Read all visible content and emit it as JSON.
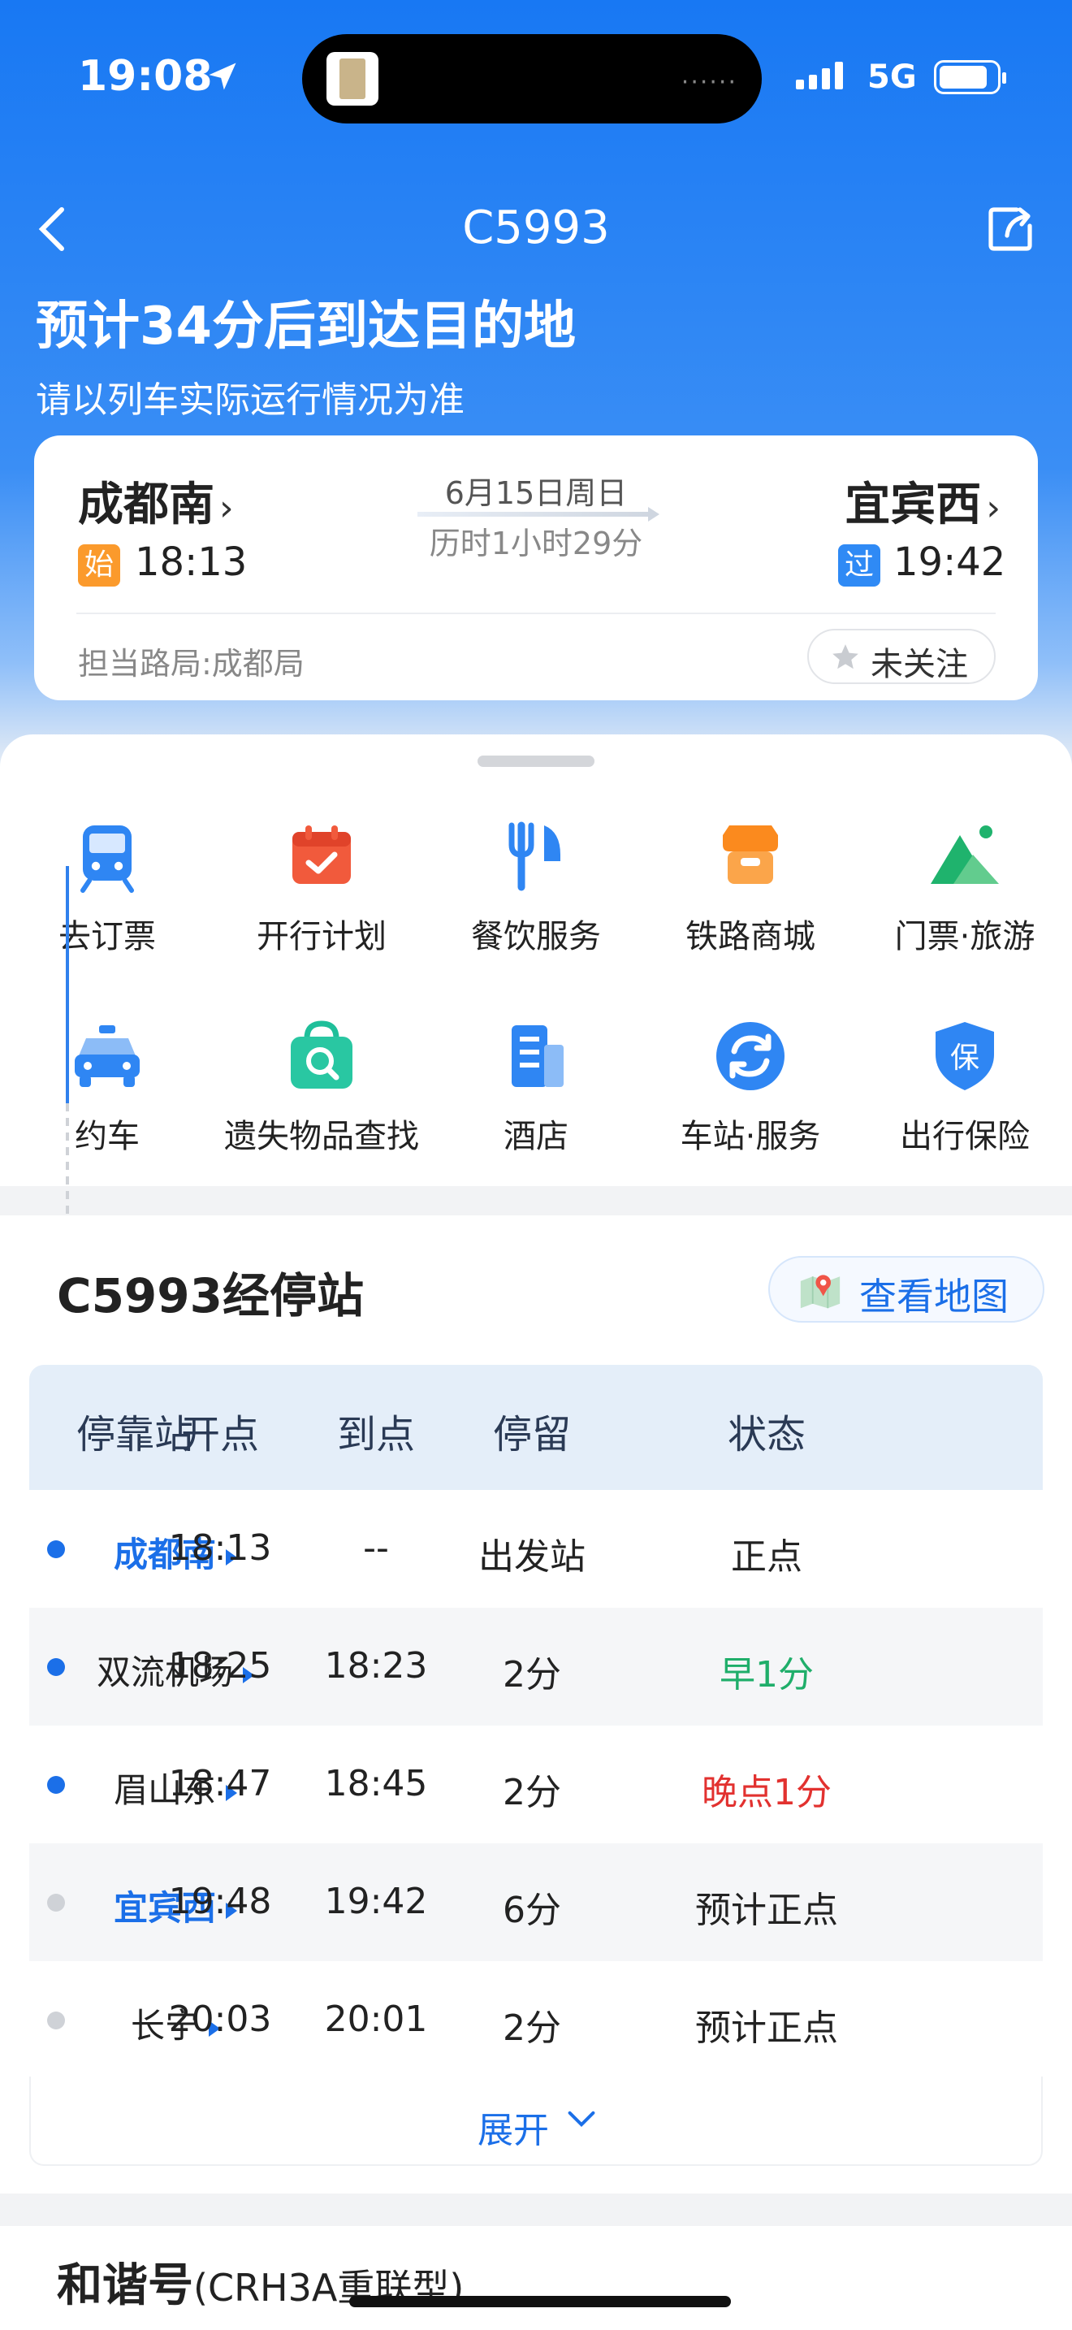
{
  "status_bar": {
    "time": "19:08",
    "network": "5G"
  },
  "nav": {
    "title": "C5993"
  },
  "header": {
    "headline": "预计34分后到达目的地",
    "subline": "请以列车实际运行情况为准"
  },
  "journey": {
    "from_station": "成都南",
    "from_tag": "始",
    "from_time": "18:13",
    "to_station": "宜宾西",
    "to_tag": "过",
    "to_time": "19:42",
    "date": "6月15日周日",
    "duration": "历时1小时29分",
    "bureau": "担当路局:成都局",
    "follow_label": "未关注"
  },
  "services": [
    {
      "label": "去订票",
      "icon": "train-icon"
    },
    {
      "label": "开行计划",
      "icon": "calendar-check-icon"
    },
    {
      "label": "餐饮服务",
      "icon": "fork-knife-icon"
    },
    {
      "label": "铁路商城",
      "icon": "shop-icon"
    },
    {
      "label": "门票·旅游",
      "icon": "mountain-icon"
    },
    {
      "label": "约车",
      "icon": "car-icon"
    },
    {
      "label": "遗失物品查找",
      "icon": "bag-search-icon"
    },
    {
      "label": "酒店",
      "icon": "building-icon"
    },
    {
      "label": "车站·服务",
      "icon": "refresh-icon"
    },
    {
      "label": "出行保险",
      "icon": "shield-icon"
    }
  ],
  "insurance_icon_char": "保",
  "stops": {
    "title": "C5993经停站",
    "map_button": "查看地图",
    "headers": [
      "停靠站",
      "开点",
      "到点",
      "停留",
      "状态"
    ],
    "rows": [
      {
        "station": "成都南",
        "depart": "18:13",
        "arrive": "--",
        "stay": "出发站",
        "status": "正点"
      },
      {
        "station": "双流机场",
        "depart": "18:25",
        "arrive": "18:23",
        "stay": "2分",
        "status": "早1分"
      },
      {
        "station": "眉山东",
        "depart": "18:47",
        "arrive": "18:45",
        "stay": "2分",
        "status": "晚点1分"
      },
      {
        "station": "宜宾西",
        "depart": "19:48",
        "arrive": "19:42",
        "stay": "6分",
        "status": "预计正点"
      },
      {
        "station": "长宁",
        "depart": "20:03",
        "arrive": "20:01",
        "stay": "2分",
        "status": "预计正点"
      }
    ],
    "expand_label": "展开"
  },
  "train": {
    "model": "和谐号",
    "variant": "(CRH3A重联型)"
  },
  "colors": {
    "brand_blue": "#1878f3",
    "early": "#1fae6a",
    "late": "#e2312f",
    "highlight": "#1b6fe8"
  }
}
